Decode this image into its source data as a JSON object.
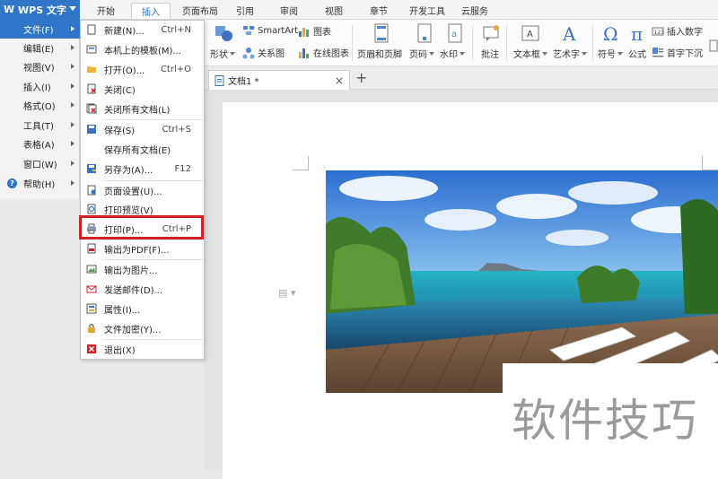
{
  "app": {
    "logo_label": "WPS 文字"
  },
  "tabs": [
    "开始",
    "插入",
    "页面布局",
    "引用",
    "审阅",
    "视图",
    "章节",
    "开发工具",
    "云服务"
  ],
  "ribbon": {
    "shape": "形状",
    "smartart": "SmartArt",
    "chart": "图表",
    "relation": "关系图",
    "online_chart": "在线图表",
    "header_footer": "页眉和页脚",
    "page_number": "页码",
    "watermark": "水印",
    "comment": "批注",
    "textbox": "文本框",
    "wordart": "艺术字",
    "symbol": "符号",
    "formula": "公式",
    "insert_number": "插入数字",
    "dropcap": "首字下沉"
  },
  "document_tab": {
    "title": "文档1 *"
  },
  "sidebar": {
    "items": [
      {
        "label": "文件(F)"
      },
      {
        "label": "编辑(E)"
      },
      {
        "label": "视图(V)"
      },
      {
        "label": "插入(I)"
      },
      {
        "label": "格式(O)"
      },
      {
        "label": "工具(T)"
      },
      {
        "label": "表格(A)"
      },
      {
        "label": "窗口(W)"
      },
      {
        "label": "帮助(H)"
      }
    ]
  },
  "file_menu": {
    "items": [
      {
        "label": "新建(N)...",
        "shortcut": "Ctrl+N"
      },
      {
        "label": "本机上的模板(M)...",
        "shortcut": ""
      },
      {
        "label": "打开(O)...",
        "shortcut": "Ctrl+O"
      },
      {
        "label": "关闭(C)",
        "shortcut": ""
      },
      {
        "label": "关闭所有文档(L)",
        "shortcut": ""
      },
      {
        "label": "保存(S)",
        "shortcut": "Ctrl+S"
      },
      {
        "label": "保存所有文档(E)",
        "shortcut": ""
      },
      {
        "label": "另存为(A)...",
        "shortcut": "F12"
      },
      {
        "label": "页面设置(U)...",
        "shortcut": ""
      },
      {
        "label": "打印预览(V)",
        "shortcut": ""
      },
      {
        "label": "打印(P)...",
        "shortcut": "Ctrl+P"
      },
      {
        "label": "输出为PDF(F)...",
        "shortcut": ""
      },
      {
        "label": "输出为图片...",
        "shortcut": ""
      },
      {
        "label": "发送邮件(D)...",
        "shortcut": ""
      },
      {
        "label": "属性(I)...",
        "shortcut": ""
      },
      {
        "label": "文件加密(Y)...",
        "shortcut": ""
      },
      {
        "label": "退出(X)",
        "shortcut": ""
      }
    ]
  },
  "watermark_text": "软件技巧",
  "colors": {
    "accent": "#2f76c8",
    "highlight": "#d22027"
  }
}
